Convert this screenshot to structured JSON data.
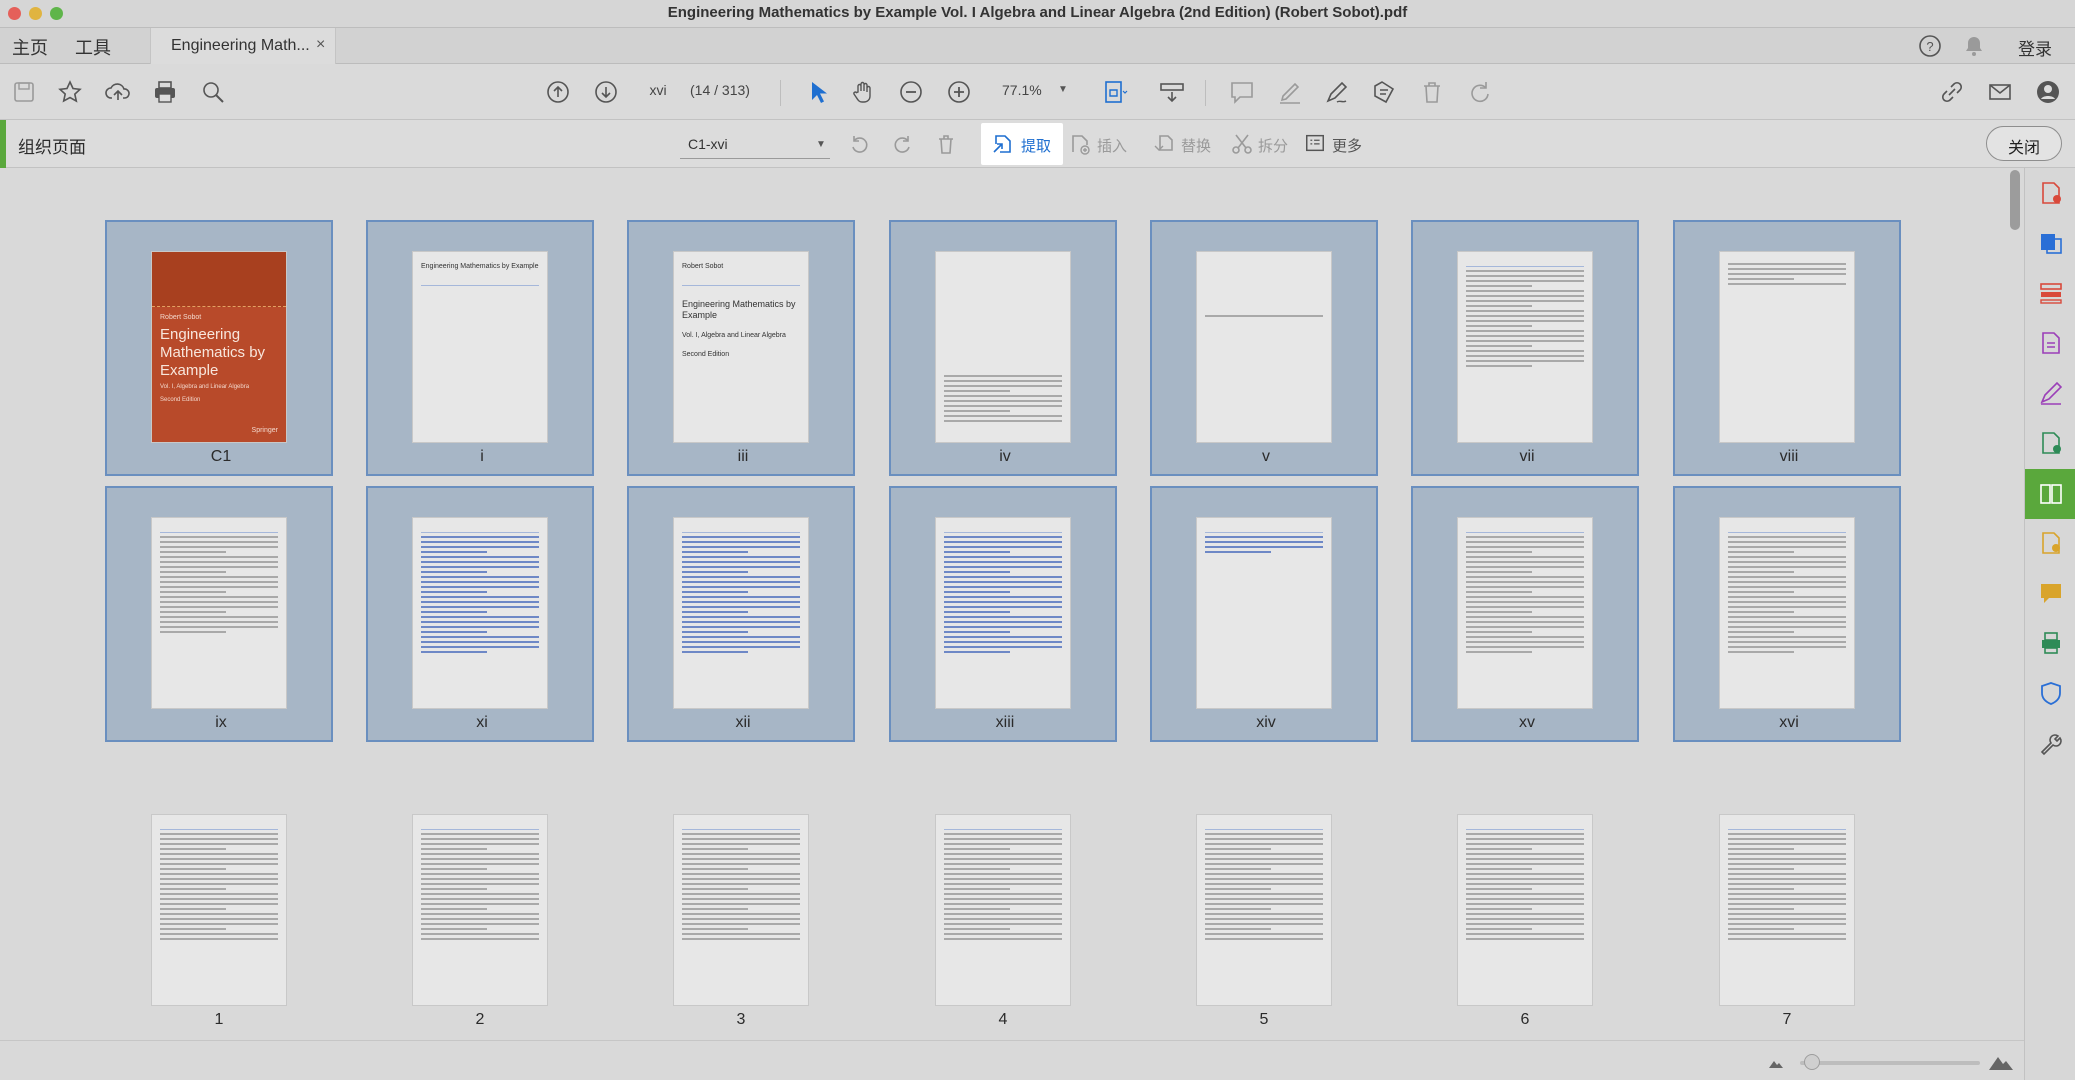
{
  "window": {
    "title": "Engineering Mathematics by Example Vol. I Algebra and Linear Algebra (2nd Edition) (Robert Sobot).pdf"
  },
  "tabbar": {
    "home": "主页",
    "tools": "工具",
    "doc_tab": "Engineering Math...",
    "close_tab": "×",
    "login": "登录"
  },
  "toolbar": {
    "page_label": "xvi",
    "page_count": "(14 / 313)",
    "zoom": "77.1%"
  },
  "organize": {
    "title": "组织页面",
    "range": "C1-xvi",
    "extract": "提取",
    "insert": "插入",
    "replace": "替换",
    "split": "拆分",
    "more": "更多",
    "close": "关闭"
  },
  "pages": [
    {
      "label": "C1",
      "selected": true,
      "kind": "cover"
    },
    {
      "label": "i",
      "selected": true,
      "kind": "halftitle"
    },
    {
      "label": "iii",
      "selected": true,
      "kind": "title"
    },
    {
      "label": "iv",
      "selected": true,
      "kind": "copyright"
    },
    {
      "label": "v",
      "selected": true,
      "kind": "dedication"
    },
    {
      "label": "vii",
      "selected": true,
      "kind": "text"
    },
    {
      "label": "viii",
      "selected": true,
      "kind": "text-sparse"
    },
    {
      "label": "ix",
      "selected": true,
      "kind": "text"
    },
    {
      "label": "xi",
      "selected": true,
      "kind": "toc"
    },
    {
      "label": "xii",
      "selected": true,
      "kind": "toc"
    },
    {
      "label": "xiii",
      "selected": true,
      "kind": "toc"
    },
    {
      "label": "xiv",
      "selected": true,
      "kind": "toc-short"
    },
    {
      "label": "xv",
      "selected": true,
      "kind": "list"
    },
    {
      "label": "xvi",
      "selected": true,
      "kind": "list"
    },
    {
      "label": "1",
      "selected": false,
      "kind": "math"
    },
    {
      "label": "2",
      "selected": false,
      "kind": "math"
    },
    {
      "label": "3",
      "selected": false,
      "kind": "math"
    },
    {
      "label": "4",
      "selected": false,
      "kind": "math"
    },
    {
      "label": "5",
      "selected": false,
      "kind": "math"
    },
    {
      "label": "6",
      "selected": false,
      "kind": "math"
    },
    {
      "label": "7",
      "selected": false,
      "kind": "math"
    }
  ],
  "cover": {
    "author": "Robert Sobot",
    "title": "Engineering Mathematics by Example",
    "subtitle": "Vol. I, Algebra and Linear Algebra",
    "edition": "Second Edition",
    "publisher": "Springer"
  },
  "halftitle": {
    "title": "Engineering Mathematics by Example"
  },
  "titlepage": {
    "author": "Robert Sobot",
    "title": "Engineering Mathematics by Example",
    "subtitle": "Vol. I, Algebra and Linear Algebra",
    "edition": "Second Edition"
  },
  "colors": {
    "selection": "#a7b6c6",
    "selection_border": "#6a8fbf",
    "accent_green": "#5aa83c",
    "extract_blue": "#1f6fd0"
  }
}
